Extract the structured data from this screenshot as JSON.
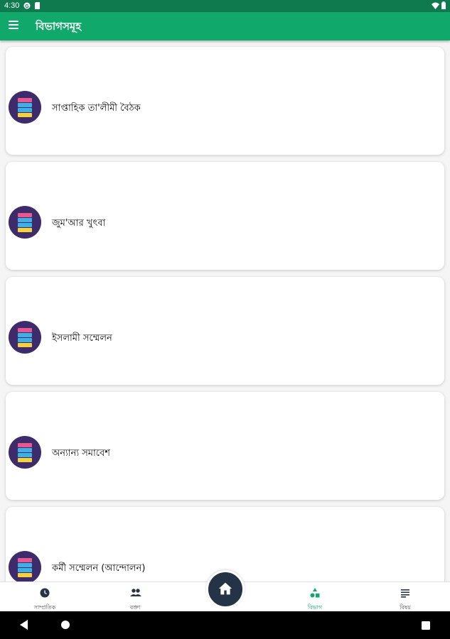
{
  "status_bar": {
    "time": "4:30",
    "icons": [
      "g-icon",
      "sd-card-icon",
      "wifi-icon",
      "battery-icon"
    ]
  },
  "app_bar": {
    "title": "বিভাগসমূহ",
    "menu_icon": "hamburger-icon"
  },
  "categories": [
    {
      "label": "সাপ্তাহিক তা'লীমী বৈঠক",
      "icon": "book-stack-icon"
    },
    {
      "label": "জুম'আর খুৎবা",
      "icon": "book-stack-icon"
    },
    {
      "label": "ইসলামী সম্মেলন",
      "icon": "book-stack-icon"
    },
    {
      "label": "অন্যান্য সমাবেশ",
      "icon": "book-stack-icon"
    },
    {
      "label": "কর্মী সম্মেলন (আন্দোলন)",
      "icon": "book-stack-icon"
    }
  ],
  "bottom_nav": {
    "items": [
      {
        "label": "সাম্প্রতিক",
        "icon": "clock-icon"
      },
      {
        "label": "বক্তা",
        "icon": "people-icon"
      },
      {
        "label": "বিভাগ",
        "icon": "shapes-icon",
        "active": true
      },
      {
        "label": "বিষয়",
        "icon": "list-icon"
      }
    ],
    "home_icon": "home-icon"
  },
  "colors": {
    "primary": "#11a86c",
    "status_bar": "#0e7a4e",
    "avatar_bg": "#3d2b6b",
    "book_pink": "#e8578f",
    "book_blue": "#3fb0e6",
    "book_yellow": "#f5d23a",
    "fab": "#253346"
  }
}
